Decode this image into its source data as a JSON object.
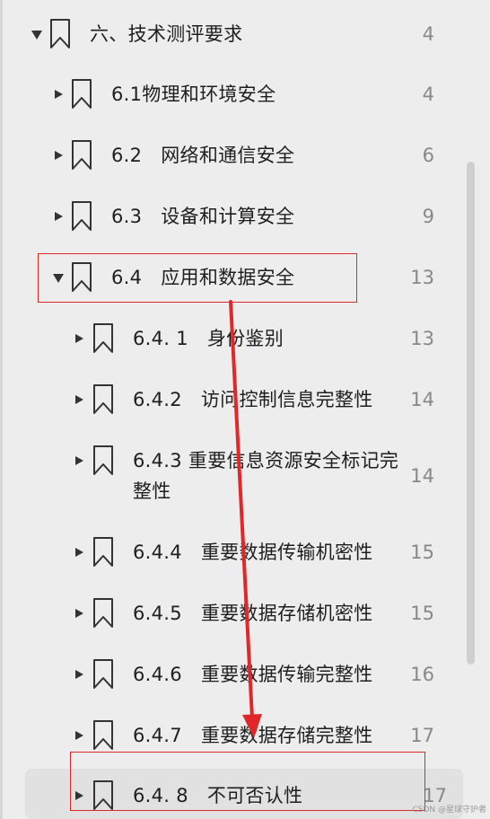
{
  "outline": {
    "items": [
      {
        "title": "六、技术测评要求",
        "page": "4"
      },
      {
        "title": "6.1物理和环境安全",
        "page": "4"
      },
      {
        "title": "6.2   网络和通信安全",
        "page": "6"
      },
      {
        "title": "6.3   设备和计算安全",
        "page": "9"
      },
      {
        "title": "6.4   应用和数据安全",
        "page": "13"
      },
      {
        "title": "6.4. 1   身份鉴别",
        "page": "13"
      },
      {
        "title": "6.4.2   访问控制信息完整性",
        "page": "14"
      },
      {
        "title": "6.4.3   重要信息资源安全标记完整性",
        "page": "14"
      },
      {
        "title": "6.4.4   重要数据传输机密性",
        "page": "15"
      },
      {
        "title": "6.4.5   重要数据存储机密性",
        "page": "15"
      },
      {
        "title": "6.4.6   重要数据传输完整性",
        "page": "16"
      },
      {
        "title": "6.4.7   重要数据存储完整性",
        "page": "17"
      },
      {
        "title": "6.4. 8   不可否认性",
        "page": "17"
      }
    ]
  },
  "watermark": "CSDN @星球守护者",
  "colors": {
    "background": "#ededed",
    "selected_row": "#e1e1e1",
    "annotation": "#e0282b",
    "page_number": "#888888"
  },
  "icons": {
    "expanded": "caret-down-icon",
    "collapsed": "caret-right-icon",
    "bookmark": "bookmark-icon"
  }
}
